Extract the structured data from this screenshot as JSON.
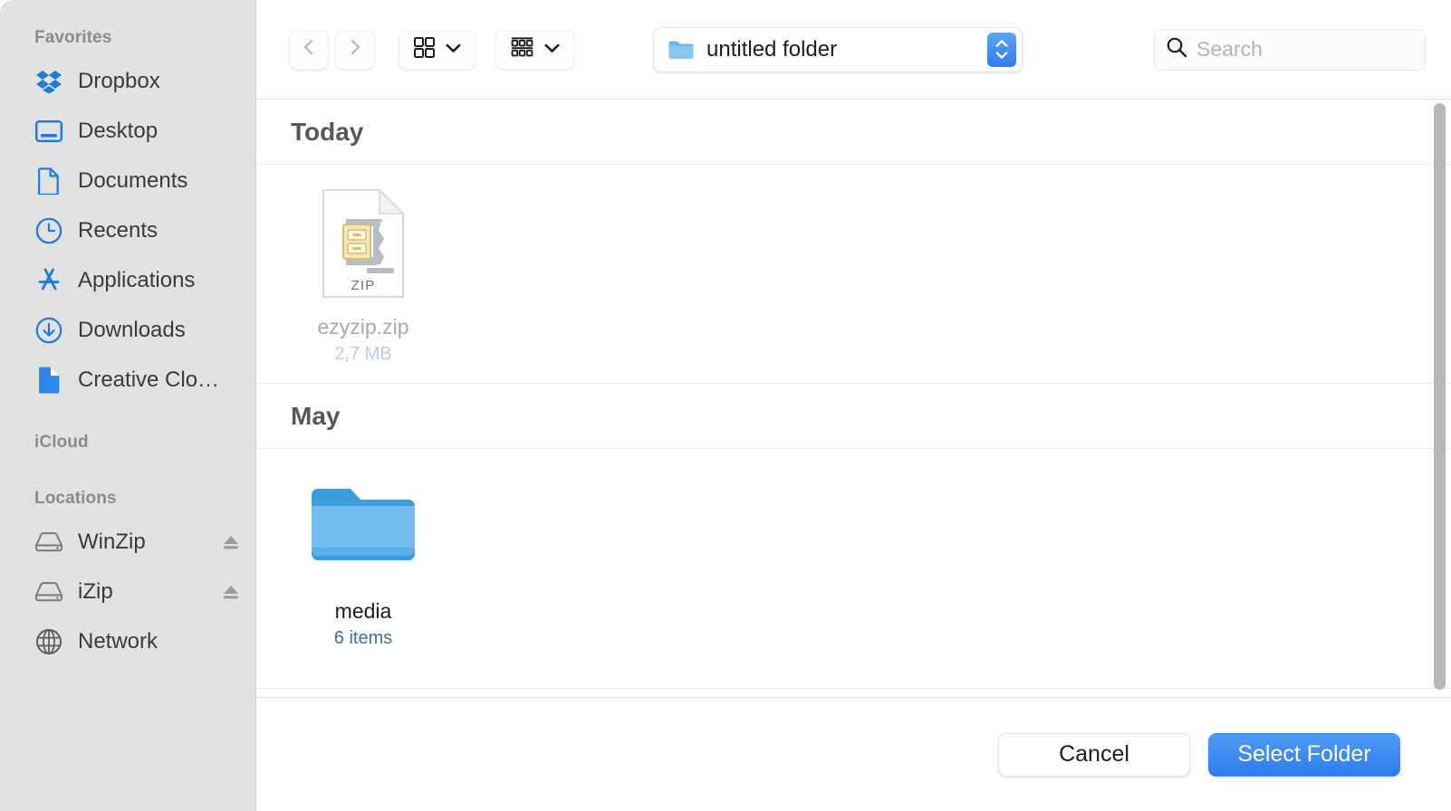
{
  "sidebar": {
    "sections": [
      {
        "title": "Favorites",
        "items": [
          {
            "label": "Dropbox",
            "icon": "dropbox-icon",
            "eject": false
          },
          {
            "label": "Desktop",
            "icon": "desktop-icon",
            "eject": false
          },
          {
            "label": "Documents",
            "icon": "document-icon",
            "eject": false
          },
          {
            "label": "Recents",
            "icon": "clock-icon",
            "eject": false
          },
          {
            "label": "Applications",
            "icon": "applications-icon",
            "eject": false
          },
          {
            "label": "Downloads",
            "icon": "download-icon",
            "eject": false
          },
          {
            "label": "Creative Clo…",
            "icon": "creative-cloud-icon",
            "eject": false
          }
        ]
      },
      {
        "title": "iCloud",
        "items": []
      },
      {
        "title": "Locations",
        "items": [
          {
            "label": "WinZip",
            "icon": "drive-icon",
            "eject": true
          },
          {
            "label": "iZip",
            "icon": "drive-icon",
            "eject": true
          },
          {
            "label": "Network",
            "icon": "network-icon",
            "eject": false
          }
        ]
      }
    ]
  },
  "toolbar": {
    "back_icon": "chevron-left-icon",
    "forward_icon": "chevron-right-icon",
    "view_mode_icon": "icon-view-icon",
    "view_mode_chevron": "chevron-down-icon",
    "group_by_icon": "group-by-icon",
    "group_by_chevron": "chevron-down-icon",
    "path": {
      "label": "untitled folder",
      "icon": "folder-icon",
      "stepper_icon": "up-down-chevron-icon"
    },
    "search": {
      "placeholder": "Search",
      "value": "",
      "icon": "search-icon"
    }
  },
  "browser": {
    "groups": [
      {
        "title": "Today",
        "items": [
          {
            "name": "ezyzip.zip",
            "subtitle": "2,7 MB",
            "kind": "zip",
            "icon": "zip-file-icon",
            "dimmed": true,
            "badge_text": "ZIP"
          }
        ]
      },
      {
        "title": "May",
        "items": [
          {
            "name": "media",
            "subtitle": "6 items",
            "kind": "folder",
            "icon": "folder-icon",
            "dimmed": false,
            "badge_text": ""
          }
        ]
      }
    ]
  },
  "footer": {
    "cancel_label": "Cancel",
    "select_label": "Select Folder"
  },
  "colors": {
    "accent": "#2d7cee",
    "sidebar_bg": "#e2e2e2",
    "icon_blue": "#1f7ae0",
    "folder_blue": "#74bdf0"
  }
}
